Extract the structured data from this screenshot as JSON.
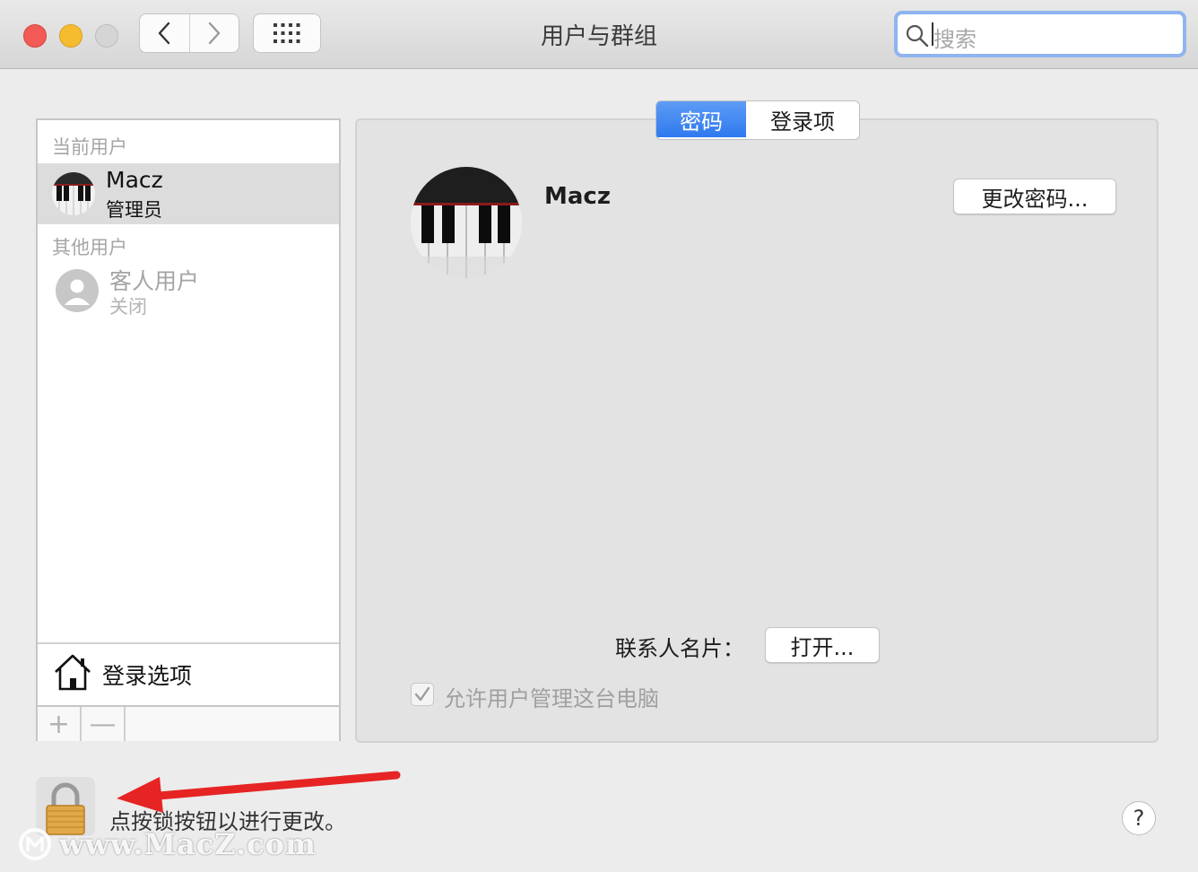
{
  "window": {
    "title": "用户与群组"
  },
  "search": {
    "placeholder": "搜索"
  },
  "sidebar": {
    "current_section": "当前用户",
    "current_user": {
      "name": "Macz",
      "role": "管理员"
    },
    "other_section": "其他用户",
    "guest": {
      "name": "客人用户",
      "status": "关闭"
    },
    "login_options": "登录选项",
    "add_label": "+",
    "remove_label": "—"
  },
  "tabs": [
    {
      "label": "密码",
      "active": true
    },
    {
      "label": "登录项",
      "active": false
    }
  ],
  "detail": {
    "user_name": "Macz",
    "change_password": "更改密码...",
    "contact_card_label": "联系人名片：",
    "open_button": "打开...",
    "allow_admin": {
      "label": "允许用户管理这台电脑",
      "checked": true,
      "enabled": false
    }
  },
  "footer": {
    "lock_message": "点按锁按钮以进行更改。",
    "help": "?"
  },
  "watermark": {
    "text": "www.MacZ.com"
  },
  "colors": {
    "accent": "#3b82f6",
    "arrow": "#e62424",
    "close": "#f25b55",
    "minimize": "#f6bc2f"
  }
}
